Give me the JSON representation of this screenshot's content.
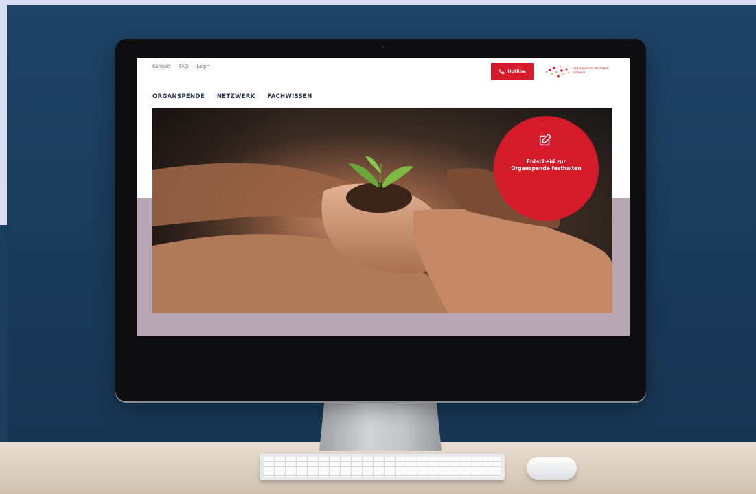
{
  "page": {
    "top_links": [
      "Kontakt",
      "FAQ",
      "Login"
    ],
    "hotline_label": "Hotline",
    "logo_text": [
      "Organspende Netzwerk",
      "Schweiz"
    ],
    "main_nav": [
      "ORGANSPENDE",
      "NETZWERK",
      "FACHWISSEN"
    ],
    "cta": {
      "line1": "Entscheid zur",
      "line2": "Organspende festhalten",
      "icon": "edit-icon"
    }
  },
  "colors": {
    "brand_red": "#d31b2a",
    "nav_text": "#2a3550",
    "wall": "#1c3d5e",
    "screen_band": "#b7a7b5"
  }
}
